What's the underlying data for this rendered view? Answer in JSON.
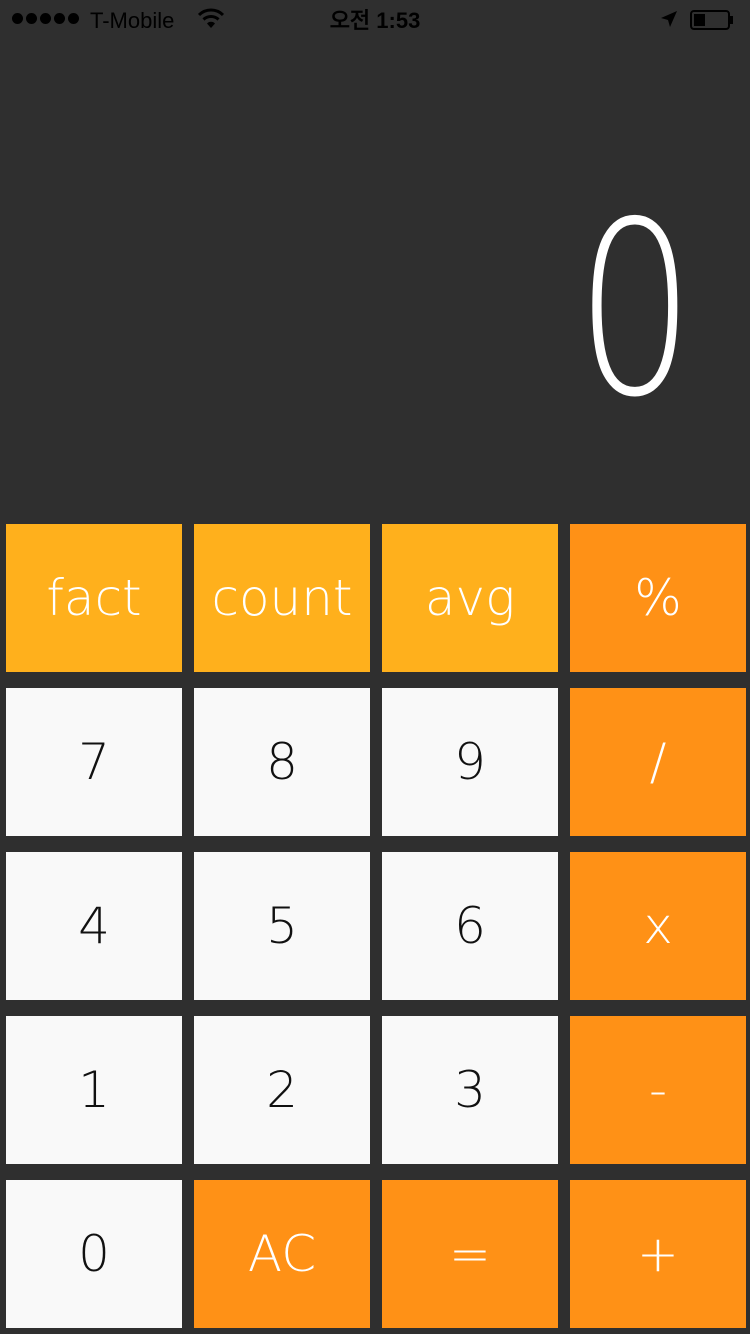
{
  "status_bar": {
    "carrier": "T-Mobile",
    "time": "오전 1:53",
    "signal_icon": "signal-dots-icon",
    "wifi_icon": "wifi-icon",
    "location_icon": "location-arrow-icon",
    "battery_icon": "battery-icon",
    "battery_level": 0.35
  },
  "display": {
    "value": "0"
  },
  "colors": {
    "background": "#2f2f2f",
    "function_key": "#ffb01c",
    "operator_key": "#ff9116",
    "number_key": "#f9f9f9"
  },
  "keys": {
    "fact": "fact",
    "count": "count",
    "avg": "avg",
    "percent": "%",
    "seven": "7",
    "eight": "8",
    "nine": "9",
    "divide": "/",
    "four": "4",
    "five": "5",
    "six": "6",
    "multiply": "x",
    "one": "1",
    "two": "2",
    "three": "3",
    "minus": "-",
    "zero": "0",
    "clear": "AC",
    "equals": "=",
    "plus": "+"
  }
}
